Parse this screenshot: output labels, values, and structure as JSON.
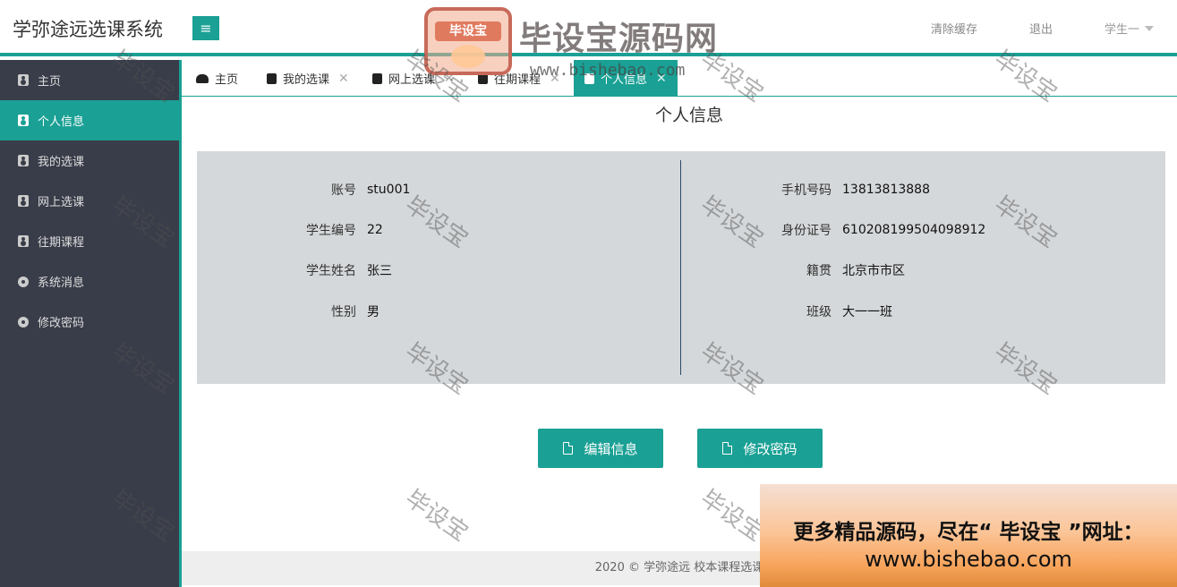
{
  "header": {
    "title": "学弥途远选课系统",
    "menu_icon": "hamburger-icon",
    "clear_cache": "清除缓存",
    "logout": "退出",
    "user": "学生一"
  },
  "logo_watermark": {
    "badge": "毕设宝",
    "main": "毕设宝源码网",
    "url": "www.bishebao.com"
  },
  "sidebar": {
    "items": [
      {
        "label": "主页",
        "icon": "user-card-icon"
      },
      {
        "label": "个人信息",
        "icon": "user-card-icon",
        "active": true
      },
      {
        "label": "我的选课",
        "icon": "user-card-icon"
      },
      {
        "label": "网上选课",
        "icon": "user-card-icon"
      },
      {
        "label": "往期课程",
        "icon": "user-card-icon"
      },
      {
        "label": "系统消息",
        "icon": "circle-dot-icon"
      },
      {
        "label": "修改密码",
        "icon": "circle-dot-icon"
      }
    ]
  },
  "tabs": [
    {
      "label": "主页",
      "icon": "dashboard-icon",
      "closable": false
    },
    {
      "label": "我的选课",
      "icon": "user-card-icon",
      "closable": true
    },
    {
      "label": "网上选课",
      "icon": "user-card-icon",
      "closable": true
    },
    {
      "label": "往期课程",
      "icon": "user-card-icon",
      "closable": true
    },
    {
      "label": "个人信息",
      "icon": "user-card-icon",
      "closable": true,
      "active": true
    }
  ],
  "tab_close_glyph": "✕",
  "page_title": "个人信息",
  "info": {
    "left": [
      {
        "label": "账号",
        "value": "stu001"
      },
      {
        "label": "学生编号",
        "value": "22"
      },
      {
        "label": "学生姓名",
        "value": "张三"
      },
      {
        "label": "性别",
        "value": "男"
      }
    ],
    "right": [
      {
        "label": "手机号码",
        "value": "13813813888"
      },
      {
        "label": "身份证号",
        "value": "610208199504098912"
      },
      {
        "label": "籍贯",
        "value": "北京市市区"
      },
      {
        "label": "班级",
        "value": "大一一班"
      }
    ]
  },
  "buttons": {
    "edit": "编辑信息",
    "change_password": "修改密码",
    "icon": "document-icon"
  },
  "footer": "2020 ©  学弥途远  校本课程选课",
  "promo": {
    "line1": "更多精品源码，尽在“ 毕设宝 ”网址：",
    "line2": "www.bishebao.com"
  },
  "watermark_text": "毕设宝",
  "colors": {
    "accent": "#1aa094",
    "sidebar_bg": "#393d49",
    "panel_bg": "#d5d8da"
  }
}
